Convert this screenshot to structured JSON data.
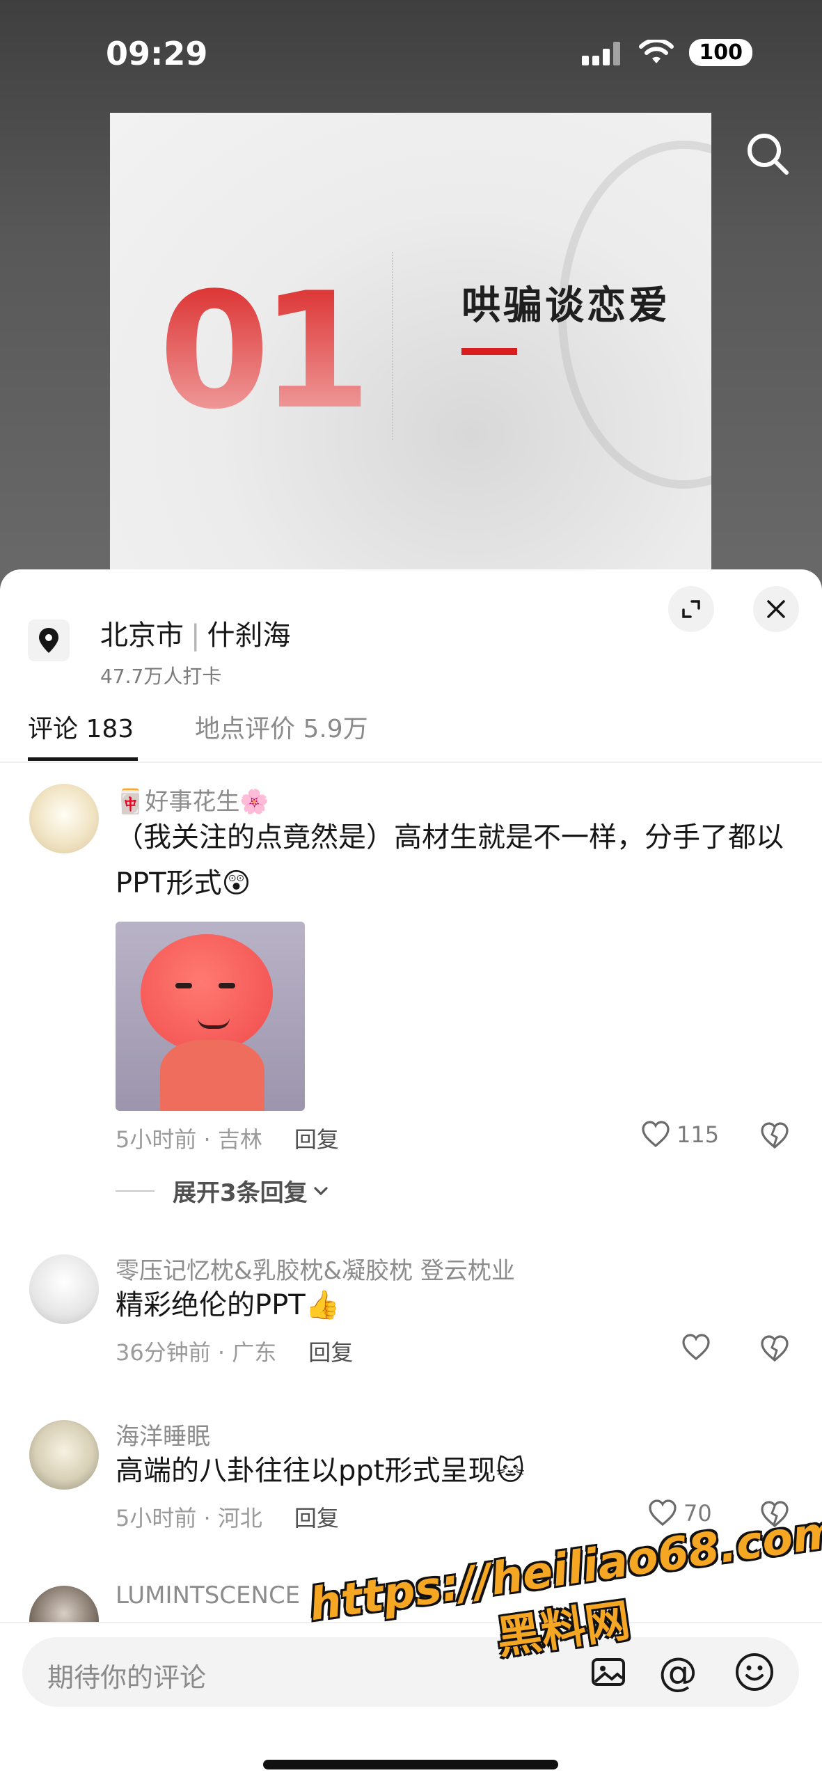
{
  "status_bar": {
    "time": "09:29",
    "battery": "100"
  },
  "slide": {
    "number": "01",
    "title": "哄骗谈恋爱"
  },
  "location": {
    "city": "北京市",
    "place": "什刹海",
    "checkins": "47.7万人打卡"
  },
  "tabs": [
    {
      "label": "评论 183",
      "active": true
    },
    {
      "label": "地点评价 5.9万",
      "active": false
    }
  ],
  "comments": [
    {
      "user": "🀄好事花生🌸 ",
      "text": "（我关注的点竟然是）高材生就是不一样，分手了都以PPT形式😲",
      "meta": "5小时前 · 吉林",
      "reply": "回复",
      "likes": "115",
      "expand": "展开3条回复"
    },
    {
      "user": "零压记忆枕&乳胶枕&凝胶枕  登云枕业",
      "text": "精彩绝伦的PPT👍",
      "meta": "36分钟前 · 广东",
      "reply": "回复",
      "likes": ""
    },
    {
      "user": "海洋睡眠",
      "text": "高端的八卦往往以ppt形式呈现🐱",
      "meta": "5小时前 · 河北",
      "reply": "回复",
      "likes": "70"
    },
    {
      "user": "LUMINTSCENCE"
    }
  ],
  "input": {
    "placeholder": "期待你的评论",
    "at_symbol": "@"
  },
  "watermark": {
    "url": "https://heiliao68.com",
    "name": "黑料网"
  },
  "colors": {
    "accent_red": "#d81e1e",
    "watermark": "#f5a623"
  },
  "icons": [
    "search-icon",
    "location-pin-icon",
    "collapse-icon",
    "close-icon",
    "heart-icon",
    "broken-heart-icon",
    "chevron-down-icon",
    "image-icon",
    "emoji-icon",
    "signal-icon",
    "wifi-icon"
  ]
}
